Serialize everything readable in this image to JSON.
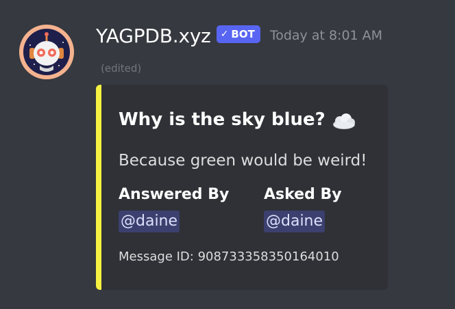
{
  "message": {
    "author": "YAGPDB.xyz",
    "bot_tag": "BOT",
    "timestamp": "Today at 8:01 AM",
    "edited": "(edited)"
  },
  "embed": {
    "accent_color": "#f5f242",
    "title": "Why is the sky blue?",
    "title_icon": "cloud-icon",
    "description": "Because green would be weird!",
    "fields": [
      {
        "name": "Answered By",
        "value": "@daine"
      },
      {
        "name": "Asked By",
        "value": "@daine"
      }
    ],
    "footer": "Message ID: 908733358350164010"
  },
  "colors": {
    "background": "#36393f",
    "embed_background": "#2f3136",
    "bot_tag": "#5865f2"
  }
}
